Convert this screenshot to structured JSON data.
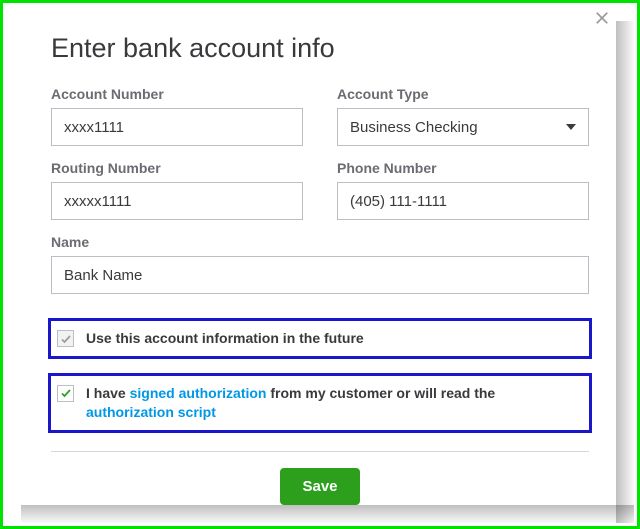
{
  "title": "Enter bank account info",
  "fields": {
    "account_number": {
      "label": "Account Number",
      "value": "xxxx1111"
    },
    "account_type": {
      "label": "Account Type",
      "value": "Business Checking"
    },
    "routing_number": {
      "label": "Routing Number",
      "value": "xxxxx1111"
    },
    "phone_number": {
      "label": "Phone Number",
      "value": "(405) 111-1111"
    },
    "name": {
      "label": "Name",
      "value": "Bank Name"
    }
  },
  "checkboxes": {
    "use_future": {
      "label": "Use this account information in the future",
      "checked": true
    },
    "auth": {
      "prefix": "I have ",
      "link1": "signed authorization",
      "mid": " from my customer or will read the ",
      "link2": "authorization script",
      "checked": true
    }
  },
  "buttons": {
    "save": "Save"
  }
}
